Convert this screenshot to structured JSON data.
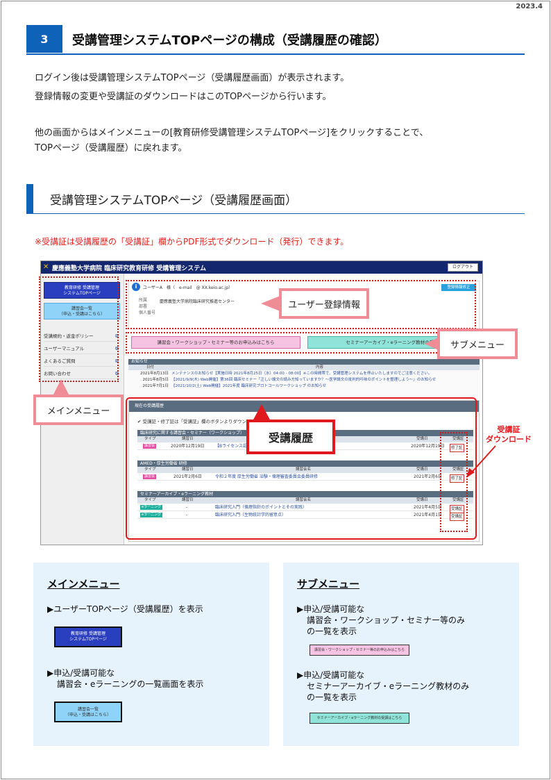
{
  "date": "2023.4",
  "section": {
    "number": "3",
    "title": "受講管理システムTOPページの構成（受講履歴の確認）"
  },
  "intro": {
    "line1": "ログイン後は受講管理システムTOPページ（受講履歴画面）が表示されます。",
    "line2": "登録情報の変更や受講証のダウンロードはこのTOPページから行います。",
    "line3": "他の画面からはメインメニューの[教育研修受講管理システムTOPページ]をクリックすることで、",
    "line4": "TOPページ（受講履歴）に戻れます。"
  },
  "subsection": {
    "title": "受講管理システムTOPページ（受講履歴画面）",
    "note": "※受講証は受講履歴の「受講証」欄からPDF形式でダウンロード（発行）できます。"
  },
  "shot": {
    "header_title": "慶應義塾大学病院 臨床研究教育研修 受講管理システム",
    "logout": "ログアウト",
    "menu_top_l1": "教育研修 受講管理",
    "menu_top_l2": "システムTOPページ",
    "menu_list_l1": "講習会一覧",
    "menu_list_l2": "（申込・受講はこちら）",
    "side_items": [
      "受講規約・返金ポリシー",
      "ユーザーマニュアル",
      "よくあるご質問",
      "お問い合わせ"
    ],
    "user_line": "ユーザーA　様（　e-mail　@ XX.keio.ac.jp）",
    "edit_button": "登録情報修正",
    "field_labels": [
      "所属",
      "部署",
      "個人番号"
    ],
    "org_name": "慶應義塾大学病院臨床研究推進センター",
    "pink_button": "講習会・ワークショップ・セミナー等のお申込みはこちら",
    "teal_button": "セミナーアーカイブ・eラーニング教材の受講",
    "notice_title": "お知らせ",
    "notice_cols": [
      "日付",
      "内容"
    ],
    "notices": [
      {
        "date": "2021年8月13日",
        "text": "メンテナンスのお知らせ【実施日時 2021年8月25日（水）04:00 - 08:00】※この時間帯で、受講管理システムを停止いたしますのでご注意ください。"
      },
      {
        "date": "2021年8月5日",
        "text": "【2021/9/9(木) Web開催】第36回 臨床セミナー「正しい論文の読み方知っていますか？～医学論文の批判的吟味のポイントを整理しよう～」のお知らせ"
      },
      {
        "date": "2021年7月1日",
        "text": "【2021/10/2(土) Web開催】2021年度 臨床研究プロトコールワークショップ のお知らせ"
      }
    ],
    "history_title": "現在の受講履歴",
    "history_note": "✔ 受講証・修了証は「受講証」欄のボタンよりダウンロード",
    "cols": [
      "タイプ",
      "講習日",
      "講習会名",
      "受講日",
      "受講証"
    ],
    "groups": [
      {
        "title": "臨床研究に関する講習会・セミナー（ワークショップ）",
        "rows": [
          {
            "type": "講習会",
            "date": "2020年12月19日",
            "name": "【Bライセンス認定",
            "attend": "2020年12月19日",
            "cert": "修了証"
          }
        ]
      },
      {
        "title": "AMED・厚生労働省 研修",
        "rows": [
          {
            "type": "講習会",
            "date": "2021年2月6日",
            "name": "令和２年度 厚生労働省 治験・倫理審査委員会委員研修",
            "attend": "2021年2月6日",
            "cert": "修了証"
          }
        ]
      },
      {
        "title": "セミナーアーカイブ・eラーニング教材",
        "rows": [
          {
            "type": "eラーニング",
            "date": "-",
            "name": "臨床研究入門（倫理指針のポイントとその実践）",
            "attend": "2021年4月5日",
            "cert": "受講証"
          },
          {
            "type": "eラーニング",
            "date": "-",
            "name": "臨床研究入門（生物統計学的留意点）",
            "attend": "2021年4月1日",
            "cert": "受講証"
          }
        ]
      }
    ]
  },
  "callouts": {
    "user_info": "ユーザー登録情報",
    "sub_menu": "サブメニュー",
    "main_menu": "メインメニュー",
    "history": "受講履歴",
    "download_l1": "受講証",
    "download_l2": "ダウンロード"
  },
  "panel_main": {
    "title": "メインメニュー",
    "item1": "▶ユーザーTOPページ（受講履歴）を表示",
    "item2_l1": "▶申込/受講可能な",
    "item2_l2": "講習会・eラーニングの一覧画面を表示"
  },
  "panel_sub": {
    "title": "サブメニュー",
    "item1_l1": "▶申込/受講可能な",
    "item1_l2": "講習会・ワークショップ・セミナー等のみ",
    "item1_l3": "の一覧を表示",
    "item2_l1": "▶申込/受講可能な",
    "item2_l2": "セミナーアーカイブ・eラーニング教材のみ",
    "item2_l3": "の一覧を表示",
    "mini_pink": "講習会・ワークショップ・セミナー等のお申込みはこちら",
    "mini_teal": "セミナーアーカイブ・eラーニング教材の受講はこちら"
  },
  "colors": {
    "accent_blue": "#0e62b8",
    "callout_pink": "#f08c96",
    "callout_red": "#e0191e"
  }
}
